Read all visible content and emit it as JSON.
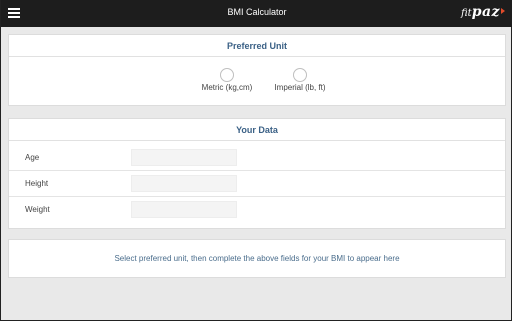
{
  "header": {
    "title": "BMI Calculator",
    "logo_text_a": "fit",
    "logo_text_b": "paz"
  },
  "unit_card": {
    "title": "Preferred Unit",
    "options": [
      {
        "label": "Metric (kg,cm)",
        "selected": false
      },
      {
        "label": "Imperial (lb, ft)",
        "selected": false
      }
    ]
  },
  "data_card": {
    "title": "Your Data",
    "fields": [
      {
        "label": "Age",
        "value": ""
      },
      {
        "label": "Height",
        "value": ""
      },
      {
        "label": "Weight",
        "value": ""
      }
    ]
  },
  "result": {
    "message": "Select preferred unit, then complete the above fields for your BMI to appear here"
  },
  "colors": {
    "topbar": "#1d1d1d",
    "heading": "#3b6186",
    "logo_accent": "#e24b2a"
  }
}
